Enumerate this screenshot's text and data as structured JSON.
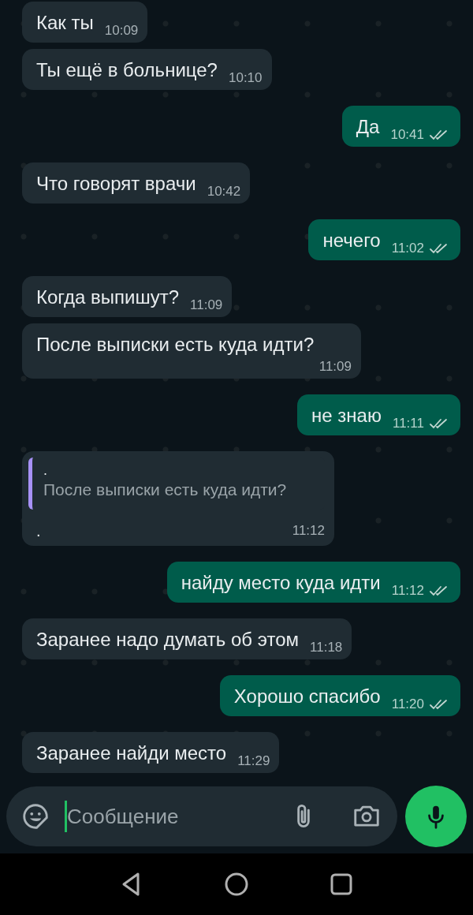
{
  "messages": [
    {
      "kind": "in",
      "text": "Как ты",
      "time": "10:09"
    },
    {
      "kind": "in",
      "text": "Ты ещё в больнице?",
      "time": "10:10"
    },
    {
      "kind": "out",
      "text": "Да",
      "time": "10:41",
      "read": true
    },
    {
      "kind": "in",
      "text": "Что говорят врачи",
      "time": "10:42"
    },
    {
      "kind": "out",
      "text": "нечего",
      "time": "11:02",
      "read": true
    },
    {
      "kind": "in",
      "text": "Когда выпишут?",
      "time": "11:09"
    },
    {
      "kind": "in",
      "text": "После выписки есть куда идти?",
      "time": "11:09"
    },
    {
      "kind": "out",
      "text": "не знаю",
      "time": "11:11",
      "read": true
    },
    {
      "kind": "reply",
      "quote_author": ".",
      "quote_text": "После выписки есть куда идти?",
      "text": ".",
      "time": "11:12"
    },
    {
      "kind": "out",
      "text": "найду место куда идти",
      "time": "11:12",
      "read": true
    },
    {
      "kind": "in",
      "text": "Заранее надо думать об этом",
      "time": "11:18"
    },
    {
      "kind": "out",
      "text": "Хорошо спасибо",
      "time": "11:20",
      "read": true
    },
    {
      "kind": "in",
      "text": "Заранее найди место",
      "time": "11:29"
    }
  ],
  "composer": {
    "placeholder": "Сообщение"
  }
}
